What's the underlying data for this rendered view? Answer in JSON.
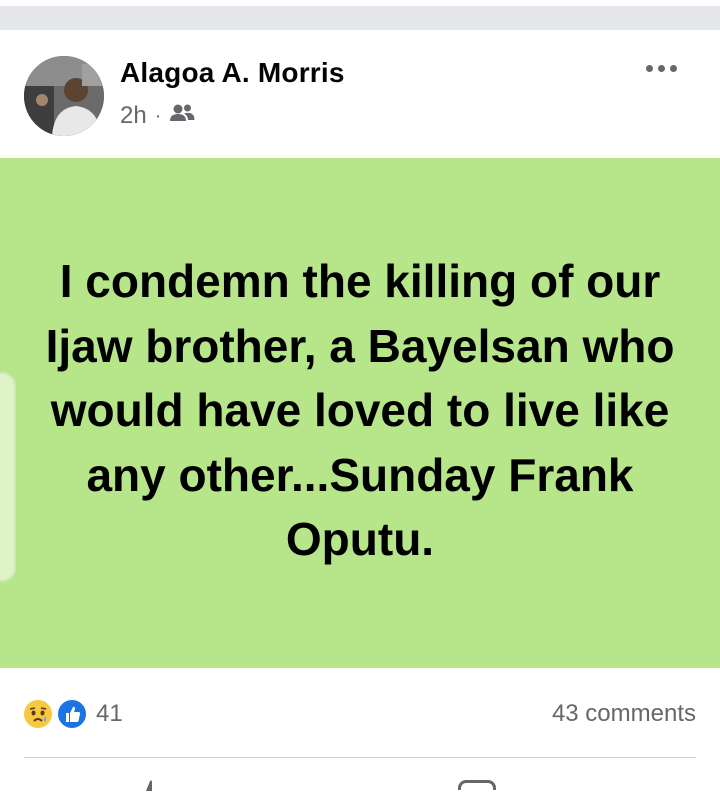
{
  "post": {
    "author": "Alagoa A. Morris",
    "time": "2h",
    "separator": "·",
    "audience_icon": "friends-icon",
    "body_text": "I condemn the killing of our Ijaw brother, a Bayelsan who would have loved to live like any other...Sunday Frank Oputu.",
    "background_color": "#b7e58a"
  },
  "reactions": {
    "icons": [
      "sad-reaction-icon",
      "like-reaction-icon"
    ],
    "count": "41",
    "comments": "43 comments"
  }
}
